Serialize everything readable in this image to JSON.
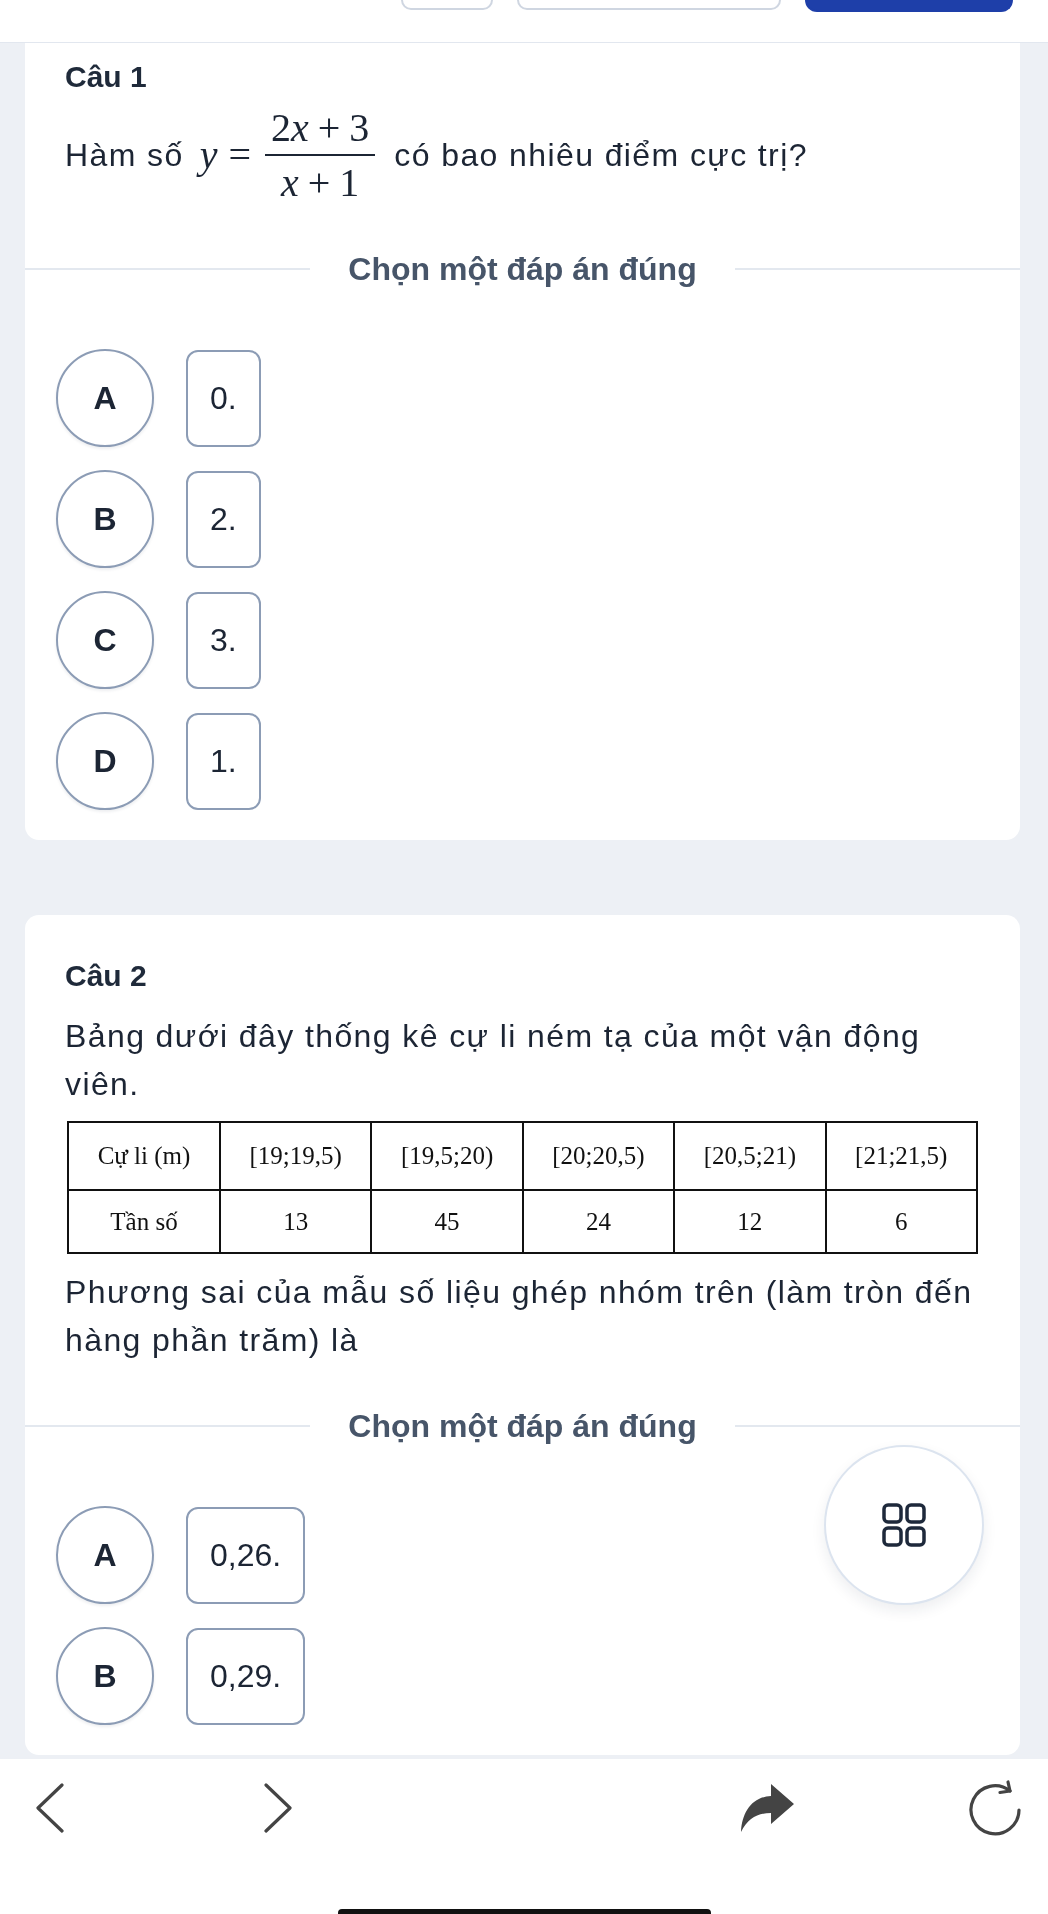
{
  "top_bar": {
    "tabs": [
      {
        "selected": false
      },
      {
        "selected": false
      },
      {
        "selected": true
      }
    ]
  },
  "questions": [
    {
      "title": "Câu 1",
      "content": [
        {
          "kind": "math_line",
          "prefix": "Hàm số",
          "formula": {
            "lhs": "y",
            "relation": "=",
            "numerator": [
              {
                "kind": "number",
                "text": "2"
              },
              {
                "kind": "variable",
                "text": "x"
              },
              {
                "kind": "operator",
                "text": "+"
              },
              {
                "kind": "number",
                "text": "3"
              }
            ],
            "denominator": [
              {
                "kind": "variable",
                "text": "x"
              },
              {
                "kind": "operator",
                "text": "+"
              },
              {
                "kind": "number",
                "text": "1"
              }
            ]
          },
          "suffix": "có bao nhiêu điểm cực trị?"
        }
      ],
      "prompt": "Chọn một đáp án đúng",
      "options": [
        {
          "letter": "A",
          "text": "0.",
          "selected": false
        },
        {
          "letter": "B",
          "text": "2.",
          "selected": false
        },
        {
          "letter": "C",
          "text": "3.",
          "selected": false
        },
        {
          "letter": "D",
          "text": "1.",
          "selected": false
        }
      ]
    },
    {
      "title": "Câu 2",
      "content": [
        {
          "kind": "paragraph",
          "text": "Bảng dưới đây thống kê cự li ném tạ của một vận động viên."
        },
        {
          "kind": "table",
          "rows": [
            [
              "Cự li (m)",
              "[19;19,5)",
              "[19,5;20)",
              "[20;20,5)",
              "[20,5;21)",
              "[21;21,5)"
            ],
            [
              "Tần số",
              "13",
              "45",
              "24",
              "12",
              "6"
            ]
          ]
        },
        {
          "kind": "paragraph",
          "text": "Phương sai của mẫu số liệu ghép nhóm trên (làm tròn đến hàng phần trăm) là"
        }
      ],
      "prompt": "Chọn một đáp án đúng",
      "options": [
        {
          "letter": "A",
          "text": "0,26.",
          "selected": false
        },
        {
          "letter": "B",
          "text": "0,29.",
          "selected": false
        }
      ]
    }
  ]
}
